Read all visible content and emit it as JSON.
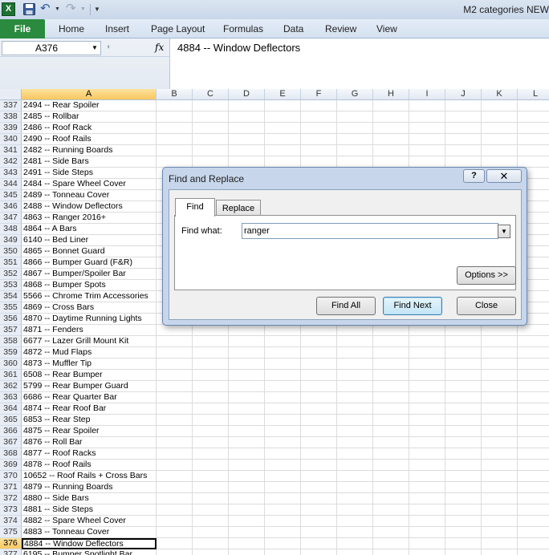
{
  "window": {
    "title": "M2 categories NEW",
    "app_icon_letter": "X"
  },
  "ribbon": {
    "tabs": [
      "File",
      "Home",
      "Insert",
      "Page Layout",
      "Formulas",
      "Data",
      "Review",
      "View"
    ]
  },
  "formula_bar": {
    "name_box": "A376",
    "fx_label": "fx",
    "content": "4884 -- Window Deflectors"
  },
  "sheet": {
    "columns": [
      "A",
      "B",
      "C",
      "D",
      "E",
      "F",
      "G",
      "H",
      "I",
      "J",
      "K",
      "L"
    ],
    "selected_column": "A",
    "active_row": 376,
    "rows": [
      {
        "n": "337",
        "a": "2494 -- Rear Spoiler"
      },
      {
        "n": "338",
        "a": "2485 -- Rollbar"
      },
      {
        "n": "339",
        "a": "2486 -- Roof Rack"
      },
      {
        "n": "340",
        "a": "2490 -- Roof Rails"
      },
      {
        "n": "341",
        "a": "2482 -- Running Boards"
      },
      {
        "n": "342",
        "a": "2481 -- Side Bars"
      },
      {
        "n": "343",
        "a": "2491 -- Side Steps"
      },
      {
        "n": "344",
        "a": "2484 -- Spare Wheel Cover"
      },
      {
        "n": "345",
        "a": "2489 -- Tonneau Cover"
      },
      {
        "n": "346",
        "a": "2488 -- Window Deflectors"
      },
      {
        "n": "347",
        "a": "4863 -- Ranger 2016+"
      },
      {
        "n": "348",
        "a": "4864 -- A Bars"
      },
      {
        "n": "349",
        "a": "6140 -- Bed Liner"
      },
      {
        "n": "350",
        "a": "4865 -- Bonnet Guard"
      },
      {
        "n": "351",
        "a": "4866 -- Bumper Guard (F&R)"
      },
      {
        "n": "352",
        "a": "4867 -- Bumper/Spoiler Bar"
      },
      {
        "n": "353",
        "a": "4868 -- Bumper Spots"
      },
      {
        "n": "354",
        "a": "5566 -- Chrome Trim Accessories"
      },
      {
        "n": "355",
        "a": "4869 -- Cross Bars"
      },
      {
        "n": "356",
        "a": "4870 -- Daytime Running Lights"
      },
      {
        "n": "357",
        "a": "4871 -- Fenders"
      },
      {
        "n": "358",
        "a": "6677 -- Lazer Grill Mount Kit"
      },
      {
        "n": "359",
        "a": "4872 -- Mud Flaps"
      },
      {
        "n": "360",
        "a": "4873 -- Muffler Tip"
      },
      {
        "n": "361",
        "a": "6508 -- Rear Bumper"
      },
      {
        "n": "362",
        "a": "5799 -- Rear Bumper Guard"
      },
      {
        "n": "363",
        "a": "6686 -- Rear Quarter Bar"
      },
      {
        "n": "364",
        "a": "4874 -- Rear Roof Bar"
      },
      {
        "n": "365",
        "a": "6853 -- Rear Step"
      },
      {
        "n": "366",
        "a": "4875 -- Rear Spoiler"
      },
      {
        "n": "367",
        "a": "4876 -- Roll Bar"
      },
      {
        "n": "368",
        "a": "4877 -- Roof Racks"
      },
      {
        "n": "369",
        "a": "4878 -- Roof Rails"
      },
      {
        "n": "370",
        "a": "10652 -- Roof Rails + Cross Bars"
      },
      {
        "n": "371",
        "a": "4879 -- Running Boards"
      },
      {
        "n": "372",
        "a": "4880 -- Side Bars"
      },
      {
        "n": "373",
        "a": "4881 -- Side Steps"
      },
      {
        "n": "374",
        "a": "4882 -- Spare Wheel Cover"
      },
      {
        "n": "375",
        "a": "4883 -- Tonneau Cover"
      },
      {
        "n": "376",
        "a": "4884 -- Window Deflectors"
      },
      {
        "n": "377",
        "a": "6195 -- Bumper Spotlight Bar"
      }
    ]
  },
  "dialog": {
    "title": "Find and Replace",
    "help_label": "?",
    "close_x_label": "✕",
    "tab_find": "Find",
    "tab_replace": "Replace",
    "find_what_label": "Find what:",
    "find_what_value": "ranger",
    "options_label": "Options >>",
    "find_all_label": "Find All",
    "find_next_label": "Find Next",
    "close_label": "Close"
  },
  "colors": {
    "file_tab": "#2a8a3e",
    "selection_header": "#f8c760"
  }
}
